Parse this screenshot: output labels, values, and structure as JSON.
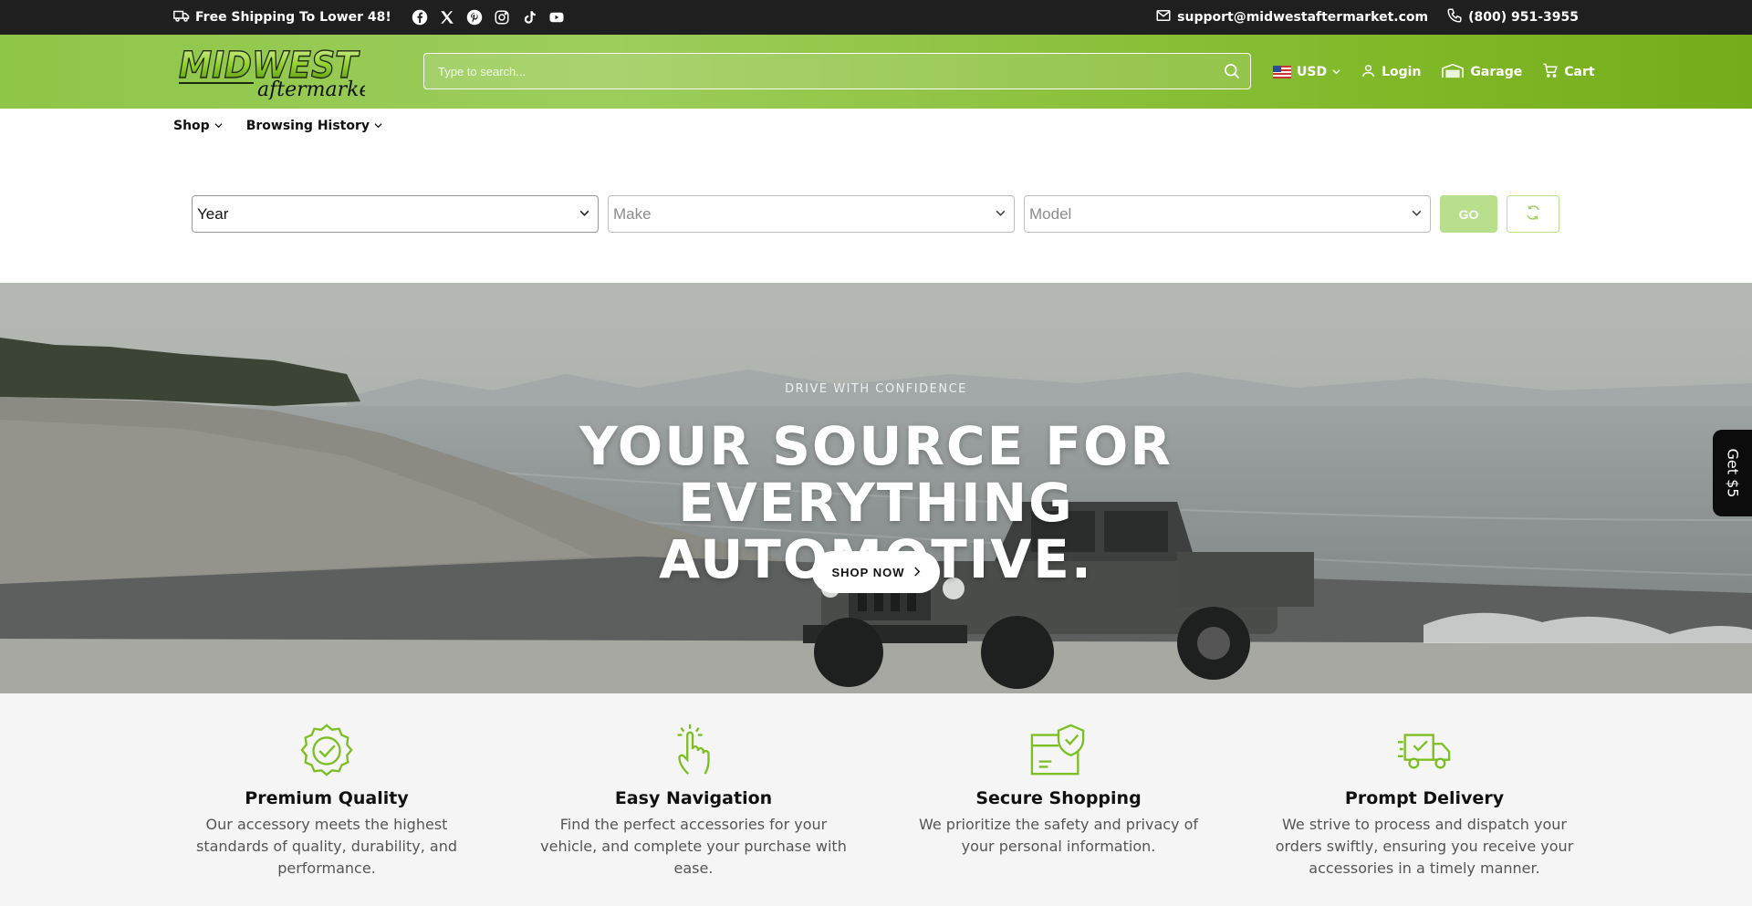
{
  "topbar": {
    "shipping_text": "Free Shipping To Lower 48!",
    "social": [
      "facebook-icon",
      "x-icon",
      "pinterest-icon",
      "instagram-icon",
      "tiktok-icon",
      "youtube-icon"
    ],
    "email": "support@midwestaftermarket.com",
    "phone": "(800) 951-3955"
  },
  "header": {
    "logo_main": "MIDWEST",
    "logo_sub": "aftermarket",
    "search_placeholder": "Type to search...",
    "currency": "USD",
    "login": "Login",
    "garage": "Garage",
    "cart": "Cart"
  },
  "nav": {
    "shop": "Shop",
    "history": "Browsing History"
  },
  "vehicle_selector": {
    "year": "Year",
    "make": "Make",
    "model": "Model",
    "go": "GO"
  },
  "hero": {
    "eyebrow": "DRIVE WITH CONFIDENCE",
    "title_line1": "YOUR SOURCE FOR EVERYTHING",
    "title_line2": "AUTOMOTIVE.",
    "cta": "SHOP NOW"
  },
  "side_tab": "Get $5",
  "features": [
    {
      "icon": "badge-check-icon",
      "title": "Premium Quality",
      "text": "Our accessory meets the highest standards of quality, durability, and performance."
    },
    {
      "icon": "pointer-hand-icon",
      "title": "Easy Navigation",
      "text": "Find the perfect accessories for your vehicle, and complete your purchase with ease."
    },
    {
      "icon": "secure-card-icon",
      "title": "Secure Shopping",
      "text": "We prioritize the safety and privacy of your personal information."
    },
    {
      "icon": "delivery-truck-icon",
      "title": "Prompt Delivery",
      "text": "We strive to process and dispatch your orders swiftly, ensuring you receive your accessories in a timely manner."
    }
  ],
  "colors": {
    "brand_green": "#8ec649",
    "accent_icon": "#7cbf22",
    "topbar_bg": "#1f1f1f"
  }
}
